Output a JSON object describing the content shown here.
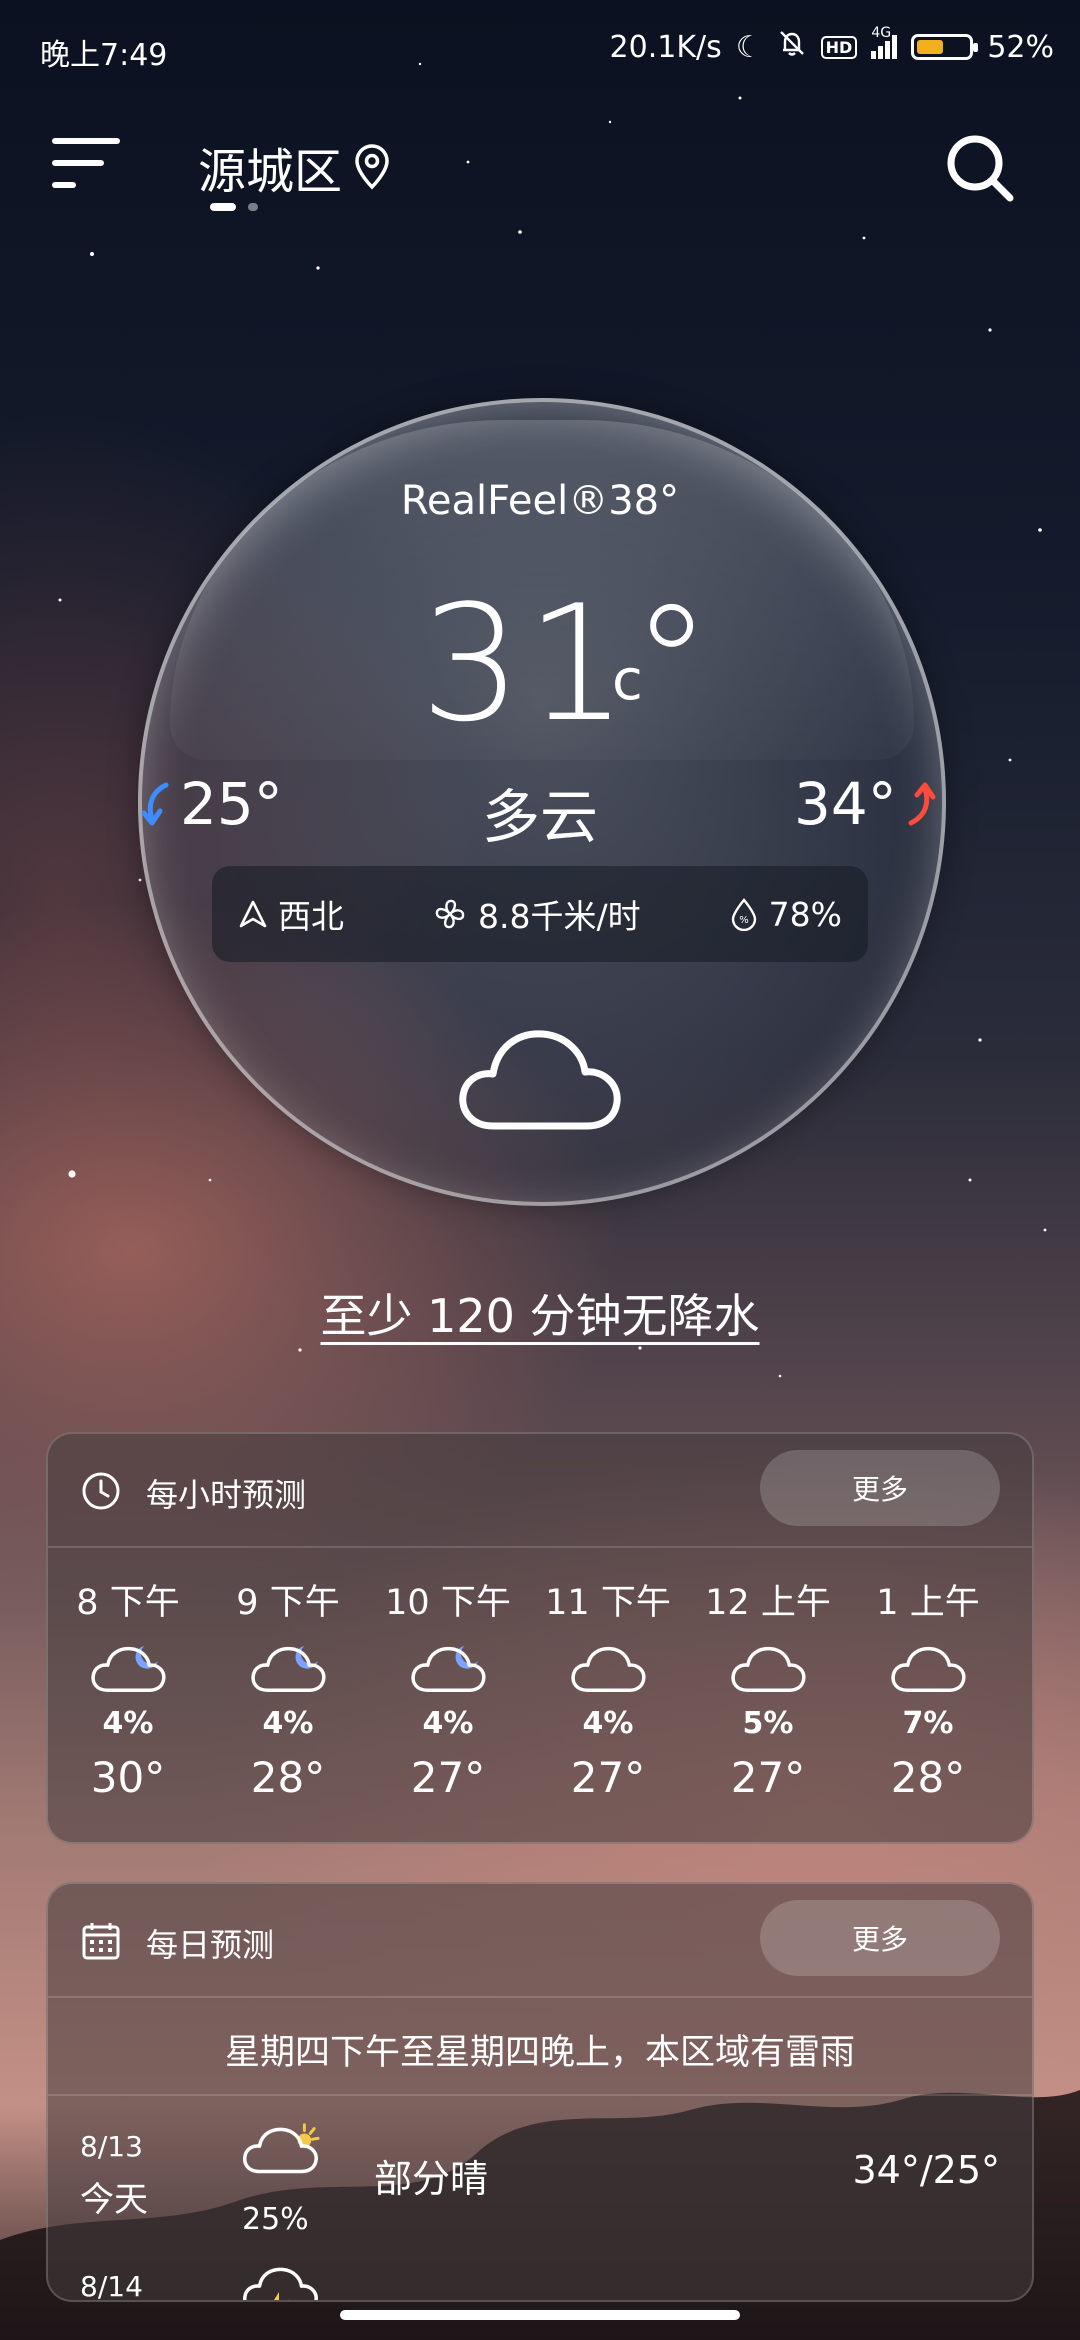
{
  "status_bar": {
    "time": "晚上7:49",
    "net_speed": "20.1K/s",
    "hd_badge": "HD",
    "network": "4G",
    "battery_pct_text": "52%",
    "battery_level": 0.52,
    "battery_color": "#f2b11c"
  },
  "header": {
    "city": "源城区",
    "page_count": 2,
    "active_page": 1
  },
  "current": {
    "realfeel_label": "RealFeel®",
    "realfeel_value": "38°",
    "temperature": "31°",
    "unit": "c",
    "low": "25°",
    "high": "34°",
    "condition": "多云",
    "wind_direction": "西北",
    "wind_speed": "8.8千米/时",
    "humidity": "78%",
    "low_arrow_color": "#3f8cff",
    "high_arrow_color": "#ff4a3d"
  },
  "nowcast": "至少 120 分钟无降水",
  "hourly": {
    "title": "每小时预测",
    "more_label": "更多",
    "items": [
      {
        "time": "8 下午",
        "icon": "cloudy-night-icon",
        "precip": "4%",
        "temp": "30°"
      },
      {
        "time": "9 下午",
        "icon": "cloudy-night-icon",
        "precip": "4%",
        "temp": "28°"
      },
      {
        "time": "10 下午",
        "icon": "cloudy-night-icon",
        "precip": "4%",
        "temp": "27°"
      },
      {
        "time": "11 下午",
        "icon": "cloud-icon",
        "precip": "4%",
        "temp": "27°"
      },
      {
        "time": "12 上午",
        "icon": "cloud-icon",
        "precip": "5%",
        "temp": "27°"
      },
      {
        "time": "1 上午",
        "icon": "cloud-icon",
        "precip": "7%",
        "temp": "28°"
      }
    ]
  },
  "daily": {
    "title": "每日预测",
    "more_label": "更多",
    "alert": "星期四下午至星期四晚上，本区域有雷雨",
    "days": [
      {
        "date": "8/13",
        "name": "今天",
        "icon": "partly-sunny-icon",
        "precip": "25%",
        "desc": "部分晴",
        "range": "34°/25°"
      },
      {
        "date": "8/14",
        "name": "",
        "icon": "thunderstorm-icon",
        "precip": "",
        "desc": "",
        "range": ""
      }
    ]
  }
}
